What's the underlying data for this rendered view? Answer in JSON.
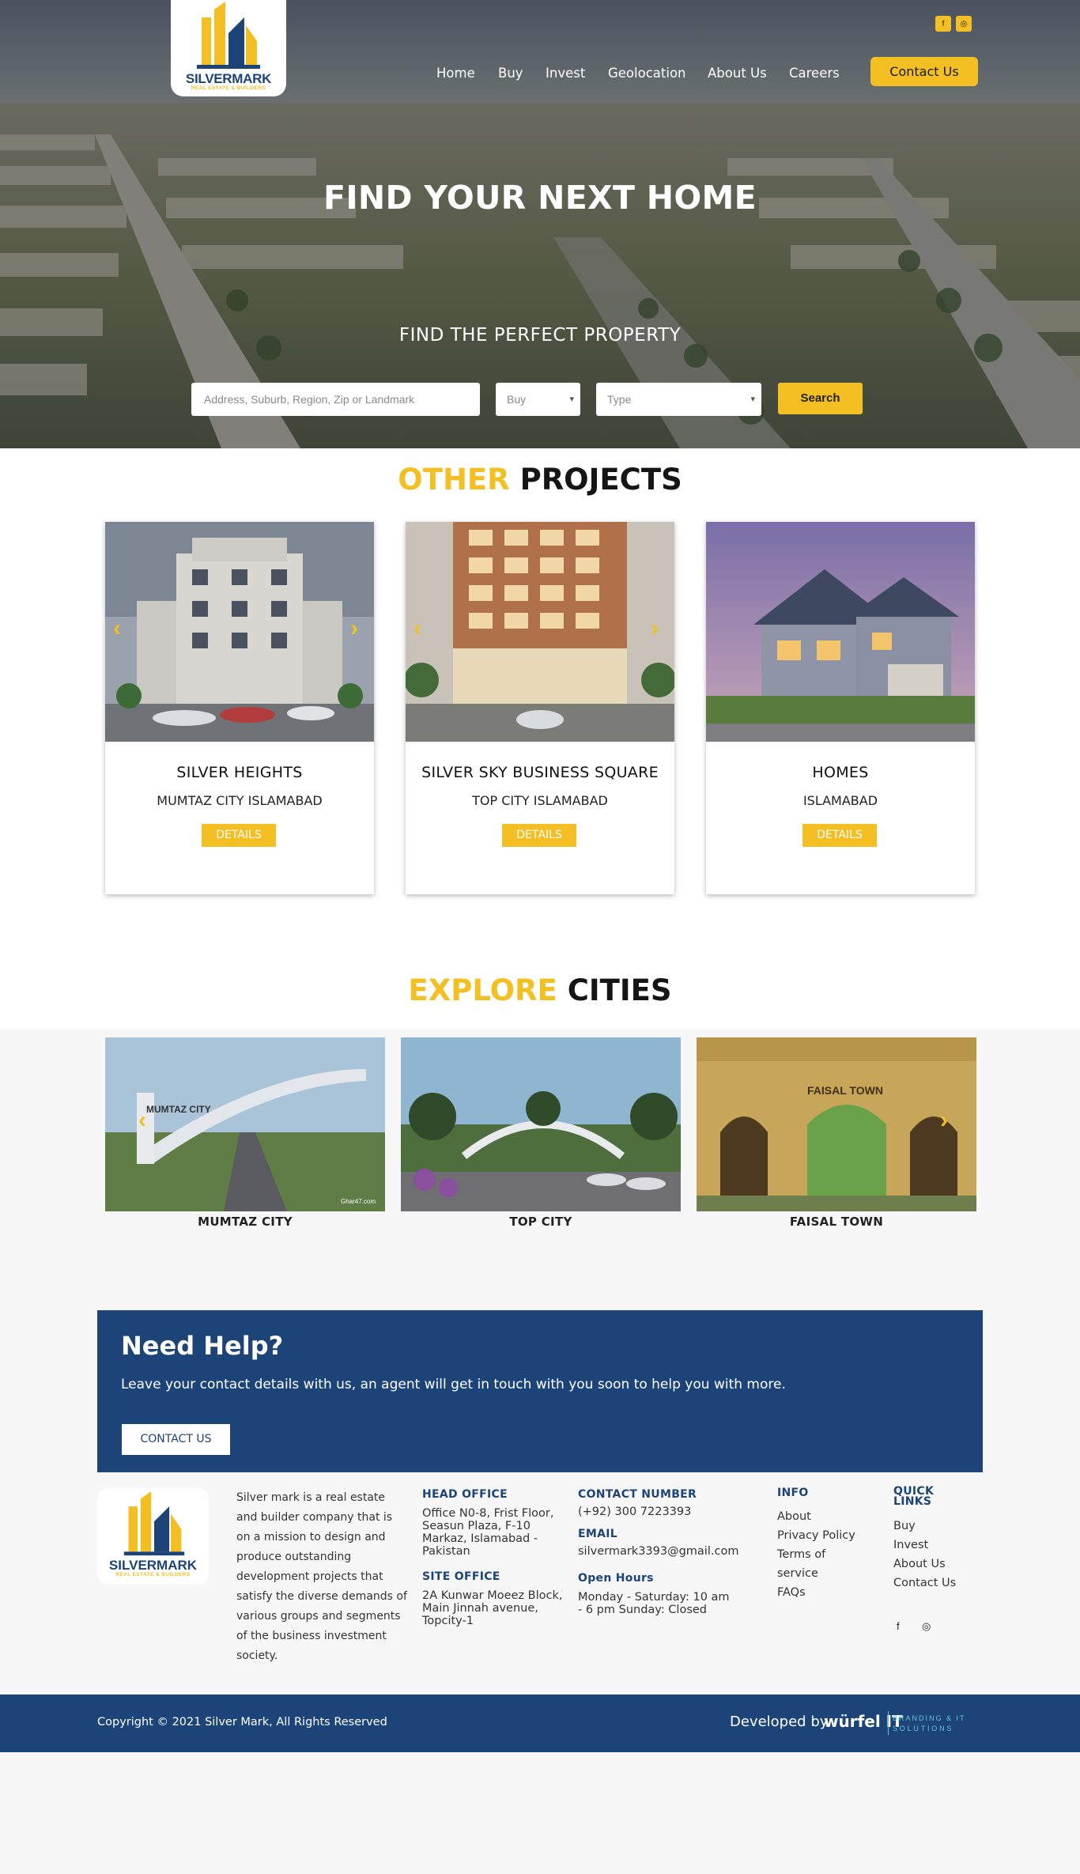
{
  "brand": {
    "name": "SILVERMARK",
    "tagline": "REAL ESTATE & BUILDERS"
  },
  "social_top": [
    {
      "icon": "facebook-icon",
      "glyph": "f"
    },
    {
      "icon": "instagram-icon",
      "glyph": "◎"
    }
  ],
  "nav": [
    "Home",
    "Buy",
    "Invest",
    "Geolocation",
    "About Us",
    "Careers"
  ],
  "contact_button": "Contact Us",
  "hero": {
    "title": "FIND YOUR NEXT HOME",
    "subtitle": "FIND THE PERFECT PROPERTY",
    "search_placeholder": "Address, Suburb, Region, Zip or Landmark",
    "buy_select": "Buy",
    "type_select": "Type",
    "search_button": "Search"
  },
  "projects": {
    "heading_accent": "OTHER",
    "heading_rest": "PROJECTS",
    "items": [
      {
        "title": "SILVER HEIGHTS",
        "location": "MUMTAZ CITY ISLAMABAD",
        "button": "DETAILS"
      },
      {
        "title": "SILVER SKY BUSINESS SQUARE",
        "location": "TOP CITY ISLAMABAD",
        "button": "DETAILS"
      },
      {
        "title": "HOMES",
        "location": "ISLAMABAD",
        "button": "DETAILS"
      }
    ]
  },
  "cities": {
    "heading_accent": "EXPLORE",
    "heading_rest": "CITIES",
    "items": [
      {
        "label": "MUMTAZ CITY",
        "sign": "MUMTAZ CITY",
        "watermark": "Ghar47.com"
      },
      {
        "label": "TOP CITY"
      },
      {
        "label": "FAISAL TOWN",
        "sign": "FAISAL TOWN"
      }
    ]
  },
  "help": {
    "title": "Need Help?",
    "text": "Leave your contact details with us, an agent will get in touch with you soon to help you with more.",
    "button": "CONTACT US"
  },
  "footer": {
    "about": "Silver mark is a real estate and builder company that is on a mission to design and produce outstanding development projects that satisfy the diverse demands of various groups and segments of the business investment society.",
    "head_office_title": "HEAD OFFICE",
    "head_office": "Office N0-8, Frist Floor, Seasun Plaza, F-10 Markaz, Islamabad - Pakistan",
    "site_office_title": "SITE OFFICE",
    "site_office": "2A Kunwar Moeez Block, Main Jinnah avenue, Topcity-1",
    "contact_title": "CONTACT NUMBER",
    "contact_number": "(+92) 300 7223393",
    "email_title": "EMAIL",
    "email": "silvermark3393@gmail.com",
    "hours_title": "Open Hours",
    "hours": "Monday - Saturday: 10 am - 6 pm Sunday: Closed",
    "info_title": "INFO",
    "info_links": [
      "About",
      "Privacy Policy",
      "Terms of",
      "service",
      "FAQs"
    ],
    "quick_title_1": "QUICK",
    "quick_title_2": "LINKS",
    "quick_links": [
      "Buy",
      "Invest",
      "About Us",
      "Contact Us"
    ],
    "social": [
      "facebook-icon",
      "instagram-icon"
    ]
  },
  "bottom_bar": {
    "copyright": "Copyright © 2021 Silver Mark, All Rights Reserved",
    "developed_by": "Developed by",
    "developer": "würfel IT",
    "developer_tag1": "BRANDING & IT",
    "developer_tag2": "SOLUTIONS"
  },
  "colors": {
    "accent": "#f3bf22",
    "navy": "#1c4478",
    "page_bg": "#f7f7f7"
  }
}
